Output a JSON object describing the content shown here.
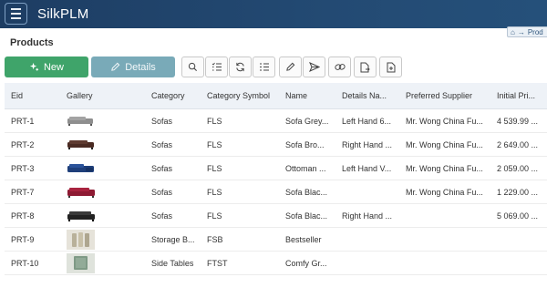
{
  "app": {
    "title": "SilkPLM"
  },
  "breadcrumb": {
    "label": "Prod"
  },
  "page": {
    "title": "Products"
  },
  "toolbar": {
    "new_label": "New",
    "details_label": "Details",
    "tools": [
      "search-icon",
      "filter-list-icon",
      "refresh-icon",
      "columns-icon",
      "edit-icon",
      "send-icon",
      "link-icon",
      "export-icon",
      "document-icon"
    ]
  },
  "table": {
    "columns": [
      "Eid",
      "Gallery",
      "Category",
      "Category Symbol",
      "Name",
      "Details Na...",
      "Preferred Supplier",
      "Initial Pri..."
    ],
    "rows": [
      {
        "eid": "PRT-1",
        "gallery": "grey-sofa",
        "category": "Sofas",
        "symbol": "FLS",
        "name": "Sofa Grey...",
        "details": "Left Hand 6...",
        "supplier": "Mr. Wong China Fu...",
        "price": "4 539.99 ..."
      },
      {
        "eid": "PRT-2",
        "gallery": "brown-sofa",
        "category": "Sofas",
        "symbol": "FLS",
        "name": "Sofa Bro...",
        "details": "Right Hand ...",
        "supplier": "Mr. Wong China Fu...",
        "price": "2 649.00 ..."
      },
      {
        "eid": "PRT-3",
        "gallery": "blue-sofa",
        "category": "Sofas",
        "symbol": "FLS",
        "name": "Ottoman ...",
        "details": "Left Hand V...",
        "supplier": "Mr. Wong China Fu...",
        "price": "2 059.00 ..."
      },
      {
        "eid": "PRT-7",
        "gallery": "red-sofa",
        "category": "Sofas",
        "symbol": "FLS",
        "name": "Sofa Blac...",
        "details": "",
        "supplier": "Mr. Wong China Fu...",
        "price": "1 229.00 ..."
      },
      {
        "eid": "PRT-8",
        "gallery": "black-sofa",
        "category": "Sofas",
        "symbol": "FLS",
        "name": "Sofa Blac...",
        "details": "Right Hand ...",
        "supplier": "",
        "price": "5 069.00 ..."
      },
      {
        "eid": "PRT-9",
        "gallery": "storage-box",
        "category": "Storage B...",
        "symbol": "FSB",
        "name": "Bestseller",
        "details": "",
        "supplier": "",
        "price": ""
      },
      {
        "eid": "PRT-10",
        "gallery": "side-table",
        "category": "Side Tables",
        "symbol": "FTST",
        "name": "Comfy Gr...",
        "details": "",
        "supplier": "",
        "price": ""
      }
    ]
  },
  "colors": {
    "topbar": "#1d3d63",
    "new_button": "#3fa46a",
    "details_button": "#79aab8",
    "header_row": "#eef2f7"
  }
}
